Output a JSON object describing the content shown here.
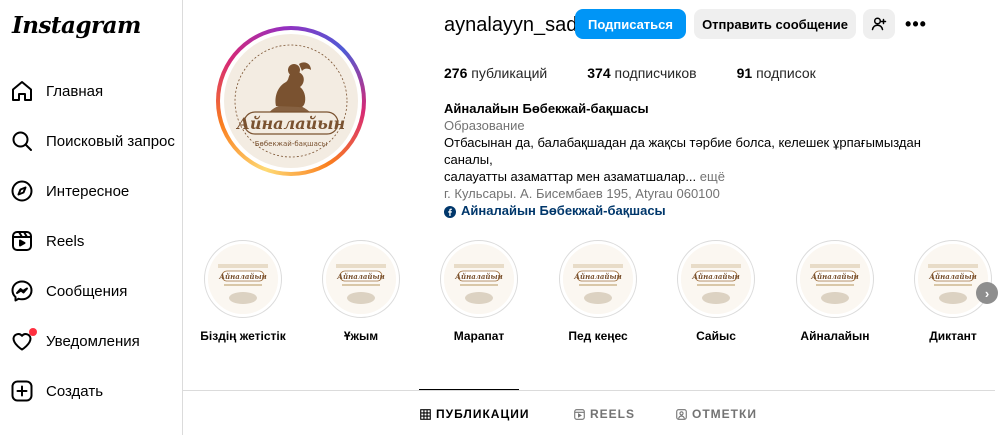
{
  "app": {
    "logo_text": "Instagram"
  },
  "sidebar": {
    "items": [
      {
        "label": "Главная",
        "icon": "home-icon"
      },
      {
        "label": "Поисковый запрос",
        "icon": "search-icon"
      },
      {
        "label": "Интересное",
        "icon": "compass-icon"
      },
      {
        "label": "Reels",
        "icon": "reels-icon"
      },
      {
        "label": "Сообщения",
        "icon": "messenger-icon"
      },
      {
        "label": "Уведомления",
        "icon": "heart-icon"
      },
      {
        "label": "Создать",
        "icon": "plus-square-icon"
      }
    ]
  },
  "profile": {
    "username": "aynalayyn_sad",
    "follow_label": "Подписаться",
    "message_label": "Отправить сообщение",
    "more_label": "•••",
    "avatar_text": "Айналайын",
    "avatar_subtext": "Бөбекжай-бақшасы",
    "stats": {
      "posts_count": "276",
      "posts_label": "публикаций",
      "followers_count": "374",
      "followers_label": "подписчиков",
      "following_count": "91",
      "following_label": "подписок"
    },
    "bio": {
      "name": "Айналайын Бөбекжай-бақшасы",
      "category": "Образование",
      "text_line1": "Отбасынан да, балабақшадан да жақсы тәрбие болса, келешек ұрпағымыздан саналы,",
      "text_line2": "салауатты азаматтар мен азаматшалар...",
      "more_label": "ещё",
      "address": "г. Кульсары. А. Бисембаев 195, Atyrau 060100",
      "link": "Айналайын Бөбекжай-бақшасы"
    }
  },
  "highlights": [
    {
      "label": "Біздің жетістік"
    },
    {
      "label": "Ұжым"
    },
    {
      "label": "Марапат"
    },
    {
      "label": "Пед кеңес"
    },
    {
      "label": "Сайыс"
    },
    {
      "label": "Айналайын"
    },
    {
      "label": "Диктант"
    }
  ],
  "highlight_thumb_text": "Айналайын",
  "tabs": [
    {
      "label": "ПУБЛИКАЦИИ",
      "active": true
    },
    {
      "label": "REELS",
      "active": false
    },
    {
      "label": "ОТМЕТКИ",
      "active": false
    }
  ],
  "colors": {
    "accent": "#0095f6",
    "notification": "#ff3040",
    "link": "#00376b",
    "brand_brown": "#7a5230"
  }
}
